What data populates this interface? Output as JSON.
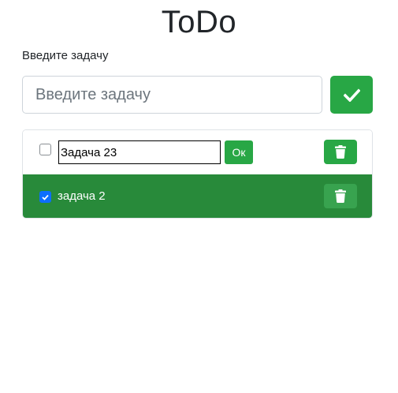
{
  "app": {
    "title": "ToDo"
  },
  "new_task": {
    "label": "Введите задачу",
    "placeholder": "Введите задачу",
    "value": "",
    "add_icon": "check-icon"
  },
  "tasks": [
    {
      "completed": false,
      "editing": true,
      "edit_value": "Задача 23",
      "confirm_label": "Ок",
      "delete_icon": "trash-icon"
    },
    {
      "completed": true,
      "editing": false,
      "text": "задача 2",
      "delete_icon": "trash-icon"
    }
  ],
  "colors": {
    "accent_green": "#28a745",
    "completed_row": "#288a3a",
    "checkbox_checked": "#0d6efd"
  }
}
